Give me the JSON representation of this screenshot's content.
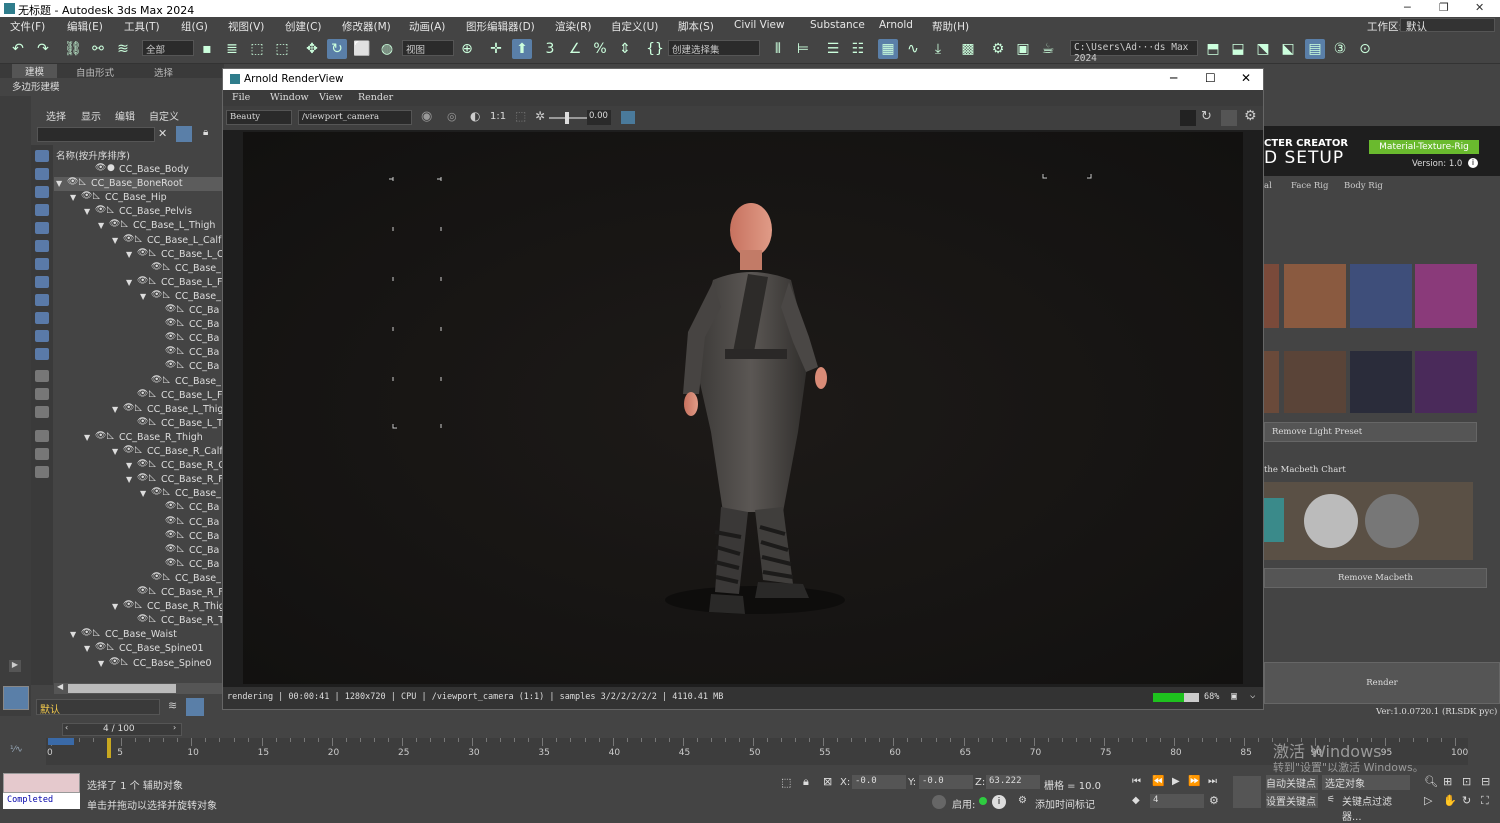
{
  "app": {
    "title": "无标题 - Autodesk 3ds Max 2024"
  },
  "menu": [
    "文件(F)",
    "编辑(E)",
    "工具(T)",
    "组(G)",
    "视图(V)",
    "创建(C)",
    "修改器(M)",
    "动画(A)",
    "图形编辑器(D)",
    "渲染(R)",
    "自定义(U)",
    "脚本(S)",
    "Civil View",
    "Substance",
    "Arnold",
    "帮助(H)"
  ],
  "workspace": {
    "label": "工作区:",
    "value": "默认"
  },
  "toolbar": {
    "selection_filter": "全部",
    "ref_coord": "视图",
    "named_selection": "创建选择集",
    "project_path": "C:\\Users\\Ad···ds Max 2024"
  },
  "ribbon_tabs": [
    "建模",
    "自由形式",
    "选择"
  ],
  "ribbon_sub": "多边形建模",
  "scene_explorer": {
    "tabs": [
      "选择",
      "显示",
      "编辑",
      "自定义"
    ],
    "header": "名称(按升序排序)",
    "layer": "默认",
    "rows": [
      "CC_Base_Body",
      "CC_Base_BoneRoot",
      "CC_Base_Hip",
      "CC_Base_Pelvis",
      "CC_Base_L_Thigh",
      "CC_Base_L_Calf",
      "CC_Base_L_C",
      "CC_Base_",
      "CC_Base_L_F",
      "CC_Base_",
      "CC_Ba",
      "CC_Ba",
      "CC_Ba",
      "CC_Ba",
      "CC_Ba",
      "CC_Base_",
      "CC_Base_L_F",
      "CC_Base_L_Thig",
      "CC_Base_L_T",
      "CC_Base_R_Thigh",
      "CC_Base_R_Calf",
      "CC_Base_R_C",
      "CC_Base_R_F",
      "CC_Base_",
      "CC_Ba",
      "CC_Ba",
      "CC_Ba",
      "CC_Ba",
      "CC_Ba",
      "CC_Base_",
      "CC_Base_R_F",
      "CC_Base_R_Thig",
      "CC_Base_R_T",
      "CC_Base_Waist",
      "CC_Base_Spine01",
      "CC_Base_Spine0"
    ]
  },
  "renderview": {
    "title": "Arnold RenderView",
    "menu": [
      "File",
      "Window",
      "View",
      "Render"
    ],
    "aov": "Beauty",
    "camera": "/viewport_camera",
    "ratio": "1:1",
    "exposure": "0.00",
    "status": "rendering | 00:00:41 | 1280x720 | CPU | /viewport_camera (1:1) | samples 3/2/2/2/2/2 | 4110.41 MB",
    "progress_label": "68%",
    "progress": 0.68
  },
  "cc_panel": {
    "title": "CTER CREATOR",
    "subtitle": "D SETUP",
    "badge": "Material-Texture-Rig",
    "version": "Version: 1.0",
    "tabs": [
      "al",
      "Face Rig",
      "Body Rig"
    ],
    "remove_light": "Remove Light Preset",
    "macbeth_label": "the Macbeth Chart",
    "remove_macbeth": "Remove Macbeth",
    "render": "Render",
    "ver": "Ver:1.0.0720.1 (RLSDK pyc)"
  },
  "timeline": {
    "frame": "4 / 100",
    "ticks": [
      "0",
      "5",
      "10",
      "15",
      "20",
      "25",
      "30",
      "35",
      "40",
      "45",
      "50",
      "55",
      "60",
      "65",
      "70",
      "75",
      "80",
      "85",
      "90",
      "95",
      "100"
    ]
  },
  "status": {
    "completed": "Completed",
    "selected": "选择了 1 个 辅助对象",
    "hint": "单击并拖动以选择并旋转对象",
    "x": "-0.0",
    "y": "-0.0",
    "z": "63.222",
    "grid": "栅格 = 10.0",
    "enable": "启用:",
    "add_tag": "添加时间标记",
    "autokey": "自动关键点",
    "setkey": "设置关键点",
    "selobj": "选定对象",
    "filter": "关键点过滤器...",
    "frame_field": "4"
  },
  "watermark": {
    "line1": "激活 Windows",
    "line2": "转到\"设置\"以激活 Windows。"
  }
}
